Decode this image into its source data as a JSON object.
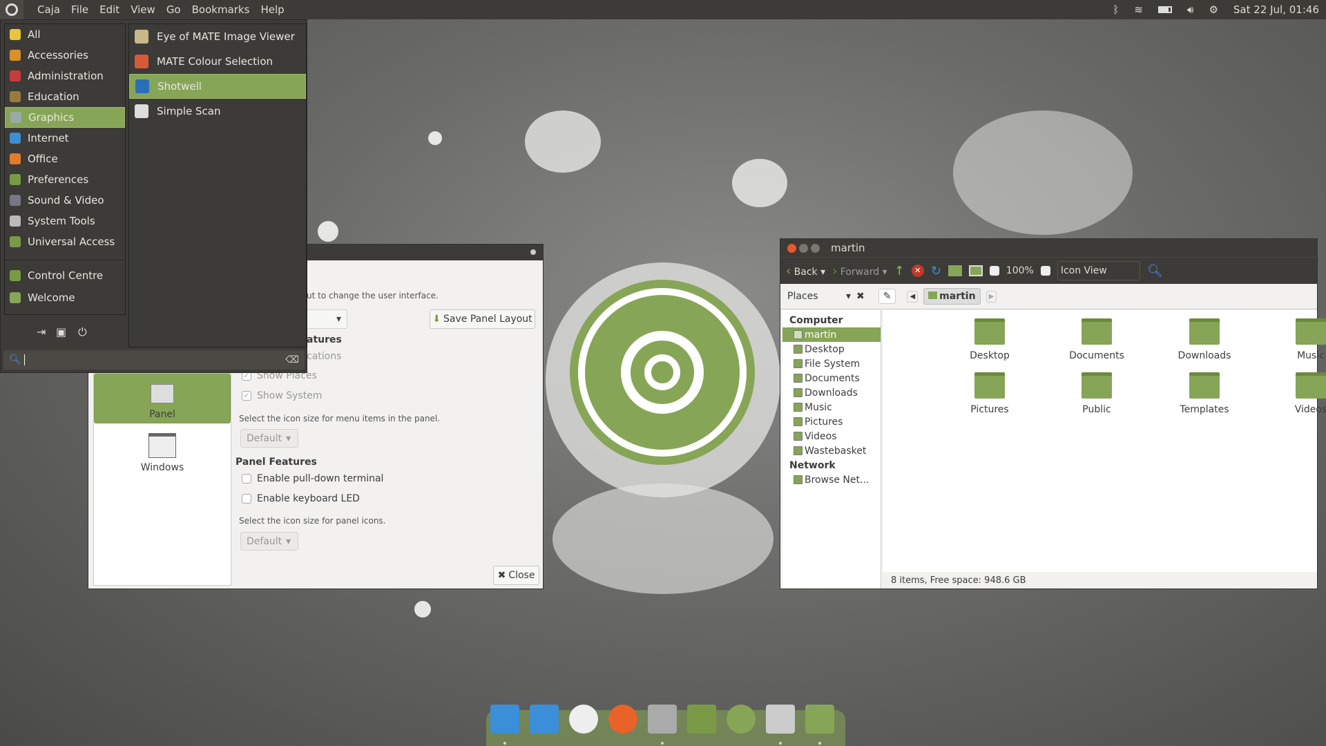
{
  "topbar": {
    "app_menu": [
      "Caja",
      "File",
      "Edit",
      "View",
      "Go",
      "Bookmarks",
      "Help"
    ],
    "tray_icons": [
      "bluetooth-icon",
      "wifi-icon",
      "battery-icon",
      "volume-icon",
      "settings-icon"
    ],
    "clock": "Sat 22 Jul, 01:46"
  },
  "menu": {
    "categories": [
      {
        "label": "All",
        "icon": "star",
        "color": "#e8c53a"
      },
      {
        "label": "Accessories",
        "icon": "accessories",
        "color": "#d9902a"
      },
      {
        "label": "Administration",
        "icon": "admin",
        "color": "#c43c3c"
      },
      {
        "label": "Education",
        "icon": "education",
        "color": "#9a7b3c"
      },
      {
        "label": "Graphics",
        "icon": "graphics",
        "color": "#9aa"
      },
      {
        "label": "Internet",
        "icon": "globe",
        "color": "#3b8fd6"
      },
      {
        "label": "Office",
        "icon": "office",
        "color": "#e07c2c"
      },
      {
        "label": "Preferences",
        "icon": "preferences",
        "color": "#7a9a48"
      },
      {
        "label": "Sound & Video",
        "icon": "sound-video",
        "color": "#778"
      },
      {
        "label": "System Tools",
        "icon": "gear",
        "color": "#bbb"
      },
      {
        "label": "Universal Access",
        "icon": "universal-access",
        "color": "#7a9a48"
      }
    ],
    "extra": [
      {
        "label": "Control Centre",
        "icon": "control-centre",
        "color": "#7a9a48"
      },
      {
        "label": "Welcome",
        "icon": "welcome",
        "color": "#87a556"
      }
    ],
    "selected_category": "Graphics",
    "apps": [
      {
        "label": "Eye of MATE Image Viewer",
        "color": "#c9b889"
      },
      {
        "label": "MATE Colour Selection",
        "color": "#d65a3a"
      },
      {
        "label": "Shotwell",
        "color": "#2a6fb8"
      },
      {
        "label": "Simple Scan",
        "color": "#ddd"
      }
    ],
    "selected_app": "Shotwell",
    "search_value": ""
  },
  "prefs": {
    "hint": "ut to change the user interface.",
    "save_layout": "Save Panel Layout",
    "section1": "atures",
    "partial_option": "cations",
    "show_places": "Show Places",
    "show_system": "Show System",
    "menu_icon_hint": "Select the icon size for menu items in the panel.",
    "menu_icon_size": "Default",
    "panel_features": "Panel Features",
    "pulldown": "Enable pull-down terminal",
    "keyboard_led": "Enable keyboard LED",
    "panel_icon_hint": "Select the icon size for panel icons.",
    "panel_icon_size": "Default",
    "close": "Close",
    "sidebar": [
      {
        "label": "Panel"
      },
      {
        "label": "Windows"
      }
    ]
  },
  "caja": {
    "title": "martin",
    "toolbar": {
      "back": "Back",
      "forward": "Forward",
      "zoom": "100%",
      "view": "Icon View"
    },
    "places_label": "Places",
    "path": "martin",
    "sidebar": [
      {
        "label": "Computer",
        "head": true
      },
      {
        "label": "martin",
        "sel": true
      },
      {
        "label": "Desktop"
      },
      {
        "label": "File System"
      },
      {
        "label": "Documents"
      },
      {
        "label": "Downloads"
      },
      {
        "label": "Music"
      },
      {
        "label": "Pictures"
      },
      {
        "label": "Videos"
      },
      {
        "label": "Wastebasket"
      },
      {
        "label": "Network",
        "head": true
      },
      {
        "label": "Browse Net..."
      }
    ],
    "files": [
      "Desktop",
      "Documents",
      "Downloads",
      "Music",
      "Pictures",
      "Public",
      "Templates",
      "Videos"
    ],
    "status": "8 items, Free space: 948.6 GB"
  },
  "dock": [
    {
      "name": "anchor",
      "color": "#3a8fd8"
    },
    {
      "name": "window",
      "color": "#3a8fd8"
    },
    {
      "name": "clock",
      "color": "#eee"
    },
    {
      "name": "firefox",
      "color": "#e8622a"
    },
    {
      "name": "file-cabinet",
      "color": "#aaa"
    },
    {
      "name": "control-centre",
      "color": "#7a9a48"
    },
    {
      "name": "ubuntu-mate",
      "color": "#87a556"
    },
    {
      "name": "tie",
      "color": "#ccc"
    },
    {
      "name": "desktop",
      "color": "#87a556"
    }
  ],
  "colors": {
    "accent": "#87a556",
    "panel": "#3c3b37"
  }
}
